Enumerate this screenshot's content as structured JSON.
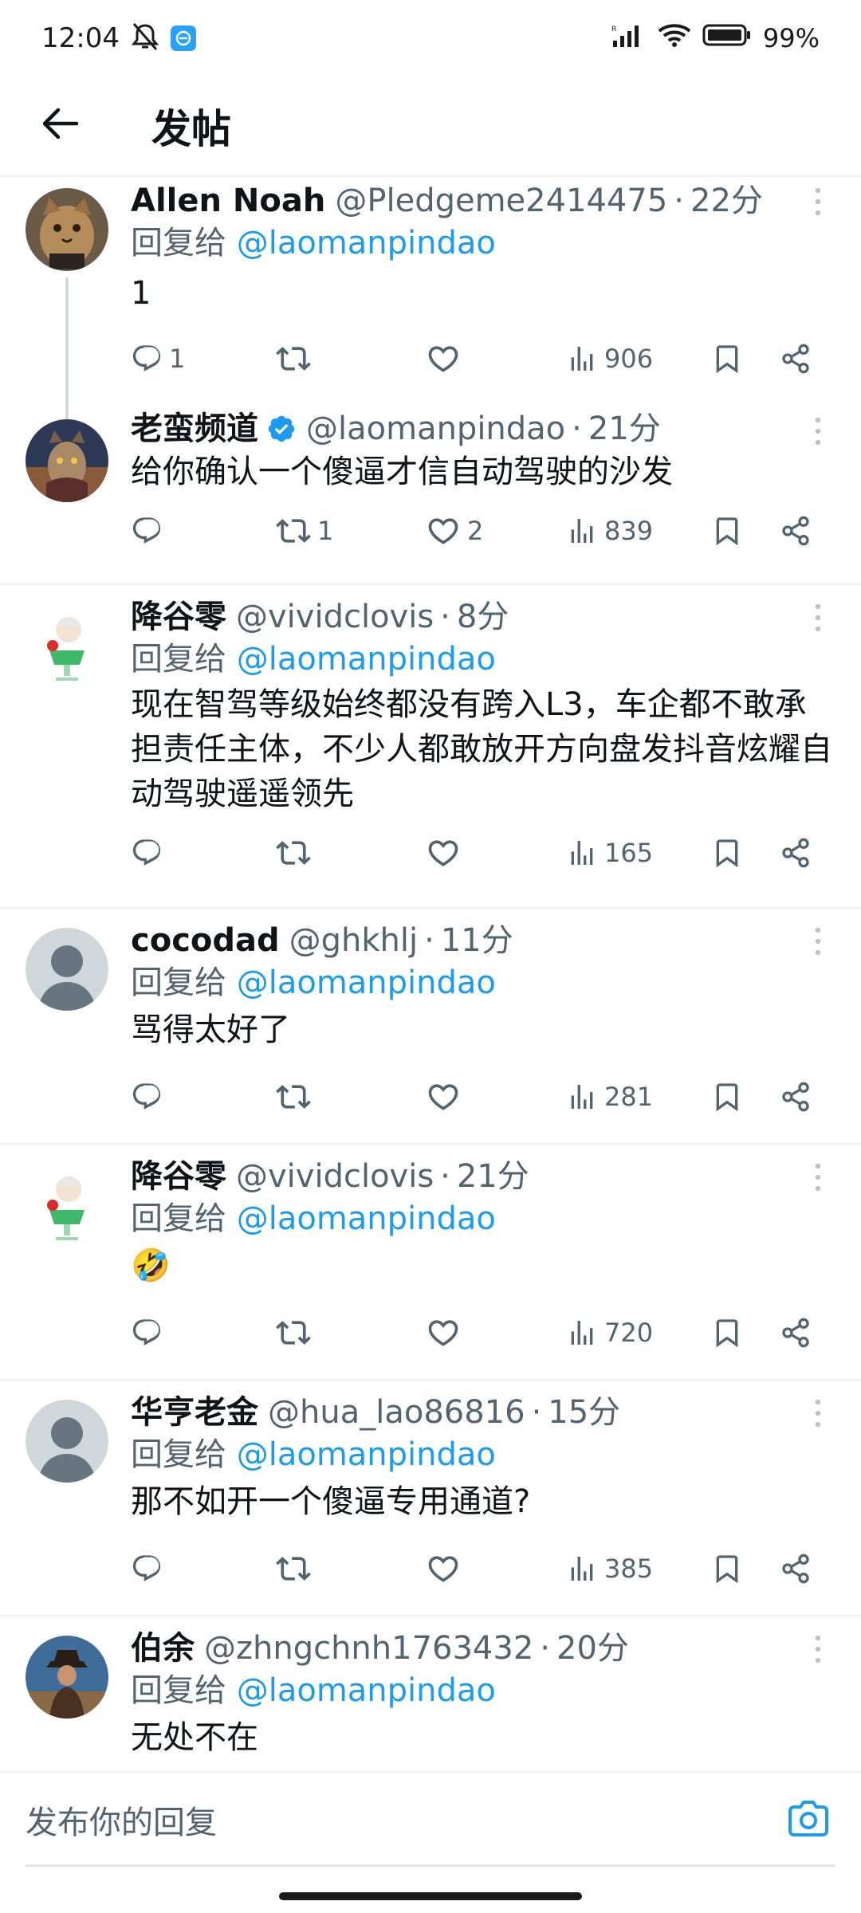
{
  "status_bar": {
    "time": "12:04",
    "battery": "99%"
  },
  "header": {
    "title": "发帖"
  },
  "posts": [
    {
      "display_name": "Allen Noah",
      "handle": "@Pledgeme2414475",
      "time": "22分",
      "reply_label": "回复给",
      "reply_mention": "@laomanpindao",
      "content": "1",
      "replies": "1",
      "reposts": "",
      "likes": "",
      "views": "906"
    },
    {
      "display_name": "老蛮频道",
      "handle": "@laomanpindao",
      "time": "21分",
      "verified": true,
      "content": "给你确认一个傻逼才信自动驾驶的沙发",
      "replies": "",
      "reposts": "1",
      "likes": "2",
      "views": "839"
    },
    {
      "display_name": "降谷零",
      "handle": "@vividclovis",
      "time": "8分",
      "reply_label": "回复给",
      "reply_mention": "@laomanpindao",
      "content": "现在智驾等级始终都没有跨入L3，车企都不敢承担责任主体，不少人都敢放开方向盘发抖音炫耀自动驾驶遥遥领先",
      "replies": "",
      "reposts": "",
      "likes": "",
      "views": "165"
    },
    {
      "display_name": "cocodad",
      "handle": "@ghkhlj",
      "time": "11分",
      "reply_label": "回复给",
      "reply_mention": "@laomanpindao",
      "content": "骂得太好了",
      "replies": "",
      "reposts": "",
      "likes": "",
      "views": "281"
    },
    {
      "display_name": "降谷零",
      "handle": "@vividclovis",
      "time": "21分",
      "reply_label": "回复给",
      "reply_mention": "@laomanpindao",
      "content": "🤣",
      "replies": "",
      "reposts": "",
      "likes": "",
      "views": "720"
    },
    {
      "display_name": "华亨老金",
      "handle": "@hua_lao86816",
      "time": "15分",
      "reply_label": "回复给",
      "reply_mention": "@laomanpindao",
      "content": "那不如开一个傻逼专用通道?",
      "replies": "",
      "reposts": "",
      "likes": "",
      "views": "385"
    },
    {
      "display_name": "伯余",
      "handle": "@zhngchnh1763432",
      "time": "20分",
      "reply_label": "回复给",
      "reply_mention": "@laomanpindao",
      "content": "无处不在"
    }
  ],
  "composer": {
    "placeholder": "发布你的回复"
  },
  "colors": {
    "accent": "#1d9bf0",
    "secondary_text": "#536471",
    "divider": "#eff3f4"
  },
  "icons": [
    "back-arrow-icon",
    "more-vertical-icon",
    "reply-icon",
    "repost-icon",
    "like-icon",
    "views-icon",
    "bookmark-icon",
    "share-icon",
    "verified-badge-icon",
    "camera-icon"
  ]
}
